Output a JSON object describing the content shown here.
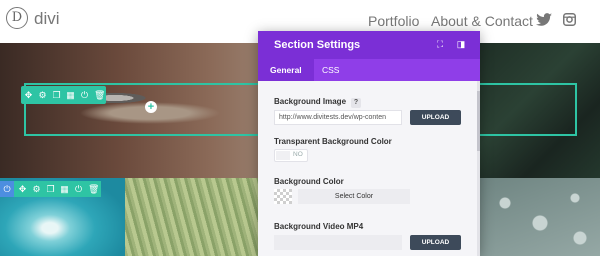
{
  "header": {
    "logo_letter": "D",
    "logo_text": "divi",
    "nav": {
      "portfolio": "Portfolio",
      "about": "About & Contact"
    }
  },
  "modal": {
    "title": "Section Settings",
    "tabs": {
      "general": "General",
      "css": "CSS"
    },
    "fields": {
      "bg_image_label": "Background Image",
      "help_glyph": "?",
      "bg_image_value": "http://www.divitests.dev/wp-conten",
      "upload_label": "UPLOAD",
      "transparent_label": "Transparent Background Color",
      "toggle_value": "NO",
      "bg_color_label": "Background Color",
      "select_color_label": "Select Color",
      "video_label": "Background Video MP4",
      "video_upload_label": "UPLOAD"
    }
  },
  "colors": {
    "modal_header": "#7b2fd6",
    "modal_tabs": "#8f3ee8",
    "builder_green": "#2ec4a4",
    "builder_blue": "#4c8ee0",
    "upload_button": "#3d4a5a"
  },
  "icons": {
    "row_toolbar": [
      "move-icon",
      "gear-icon",
      "duplicate-icon",
      "columns-icon",
      "power-icon",
      "trash-icon"
    ],
    "section_toolbar": [
      "power-icon",
      "move-icon",
      "gear-icon",
      "duplicate-icon",
      "columns-icon",
      "power-icon",
      "trash-icon"
    ]
  }
}
